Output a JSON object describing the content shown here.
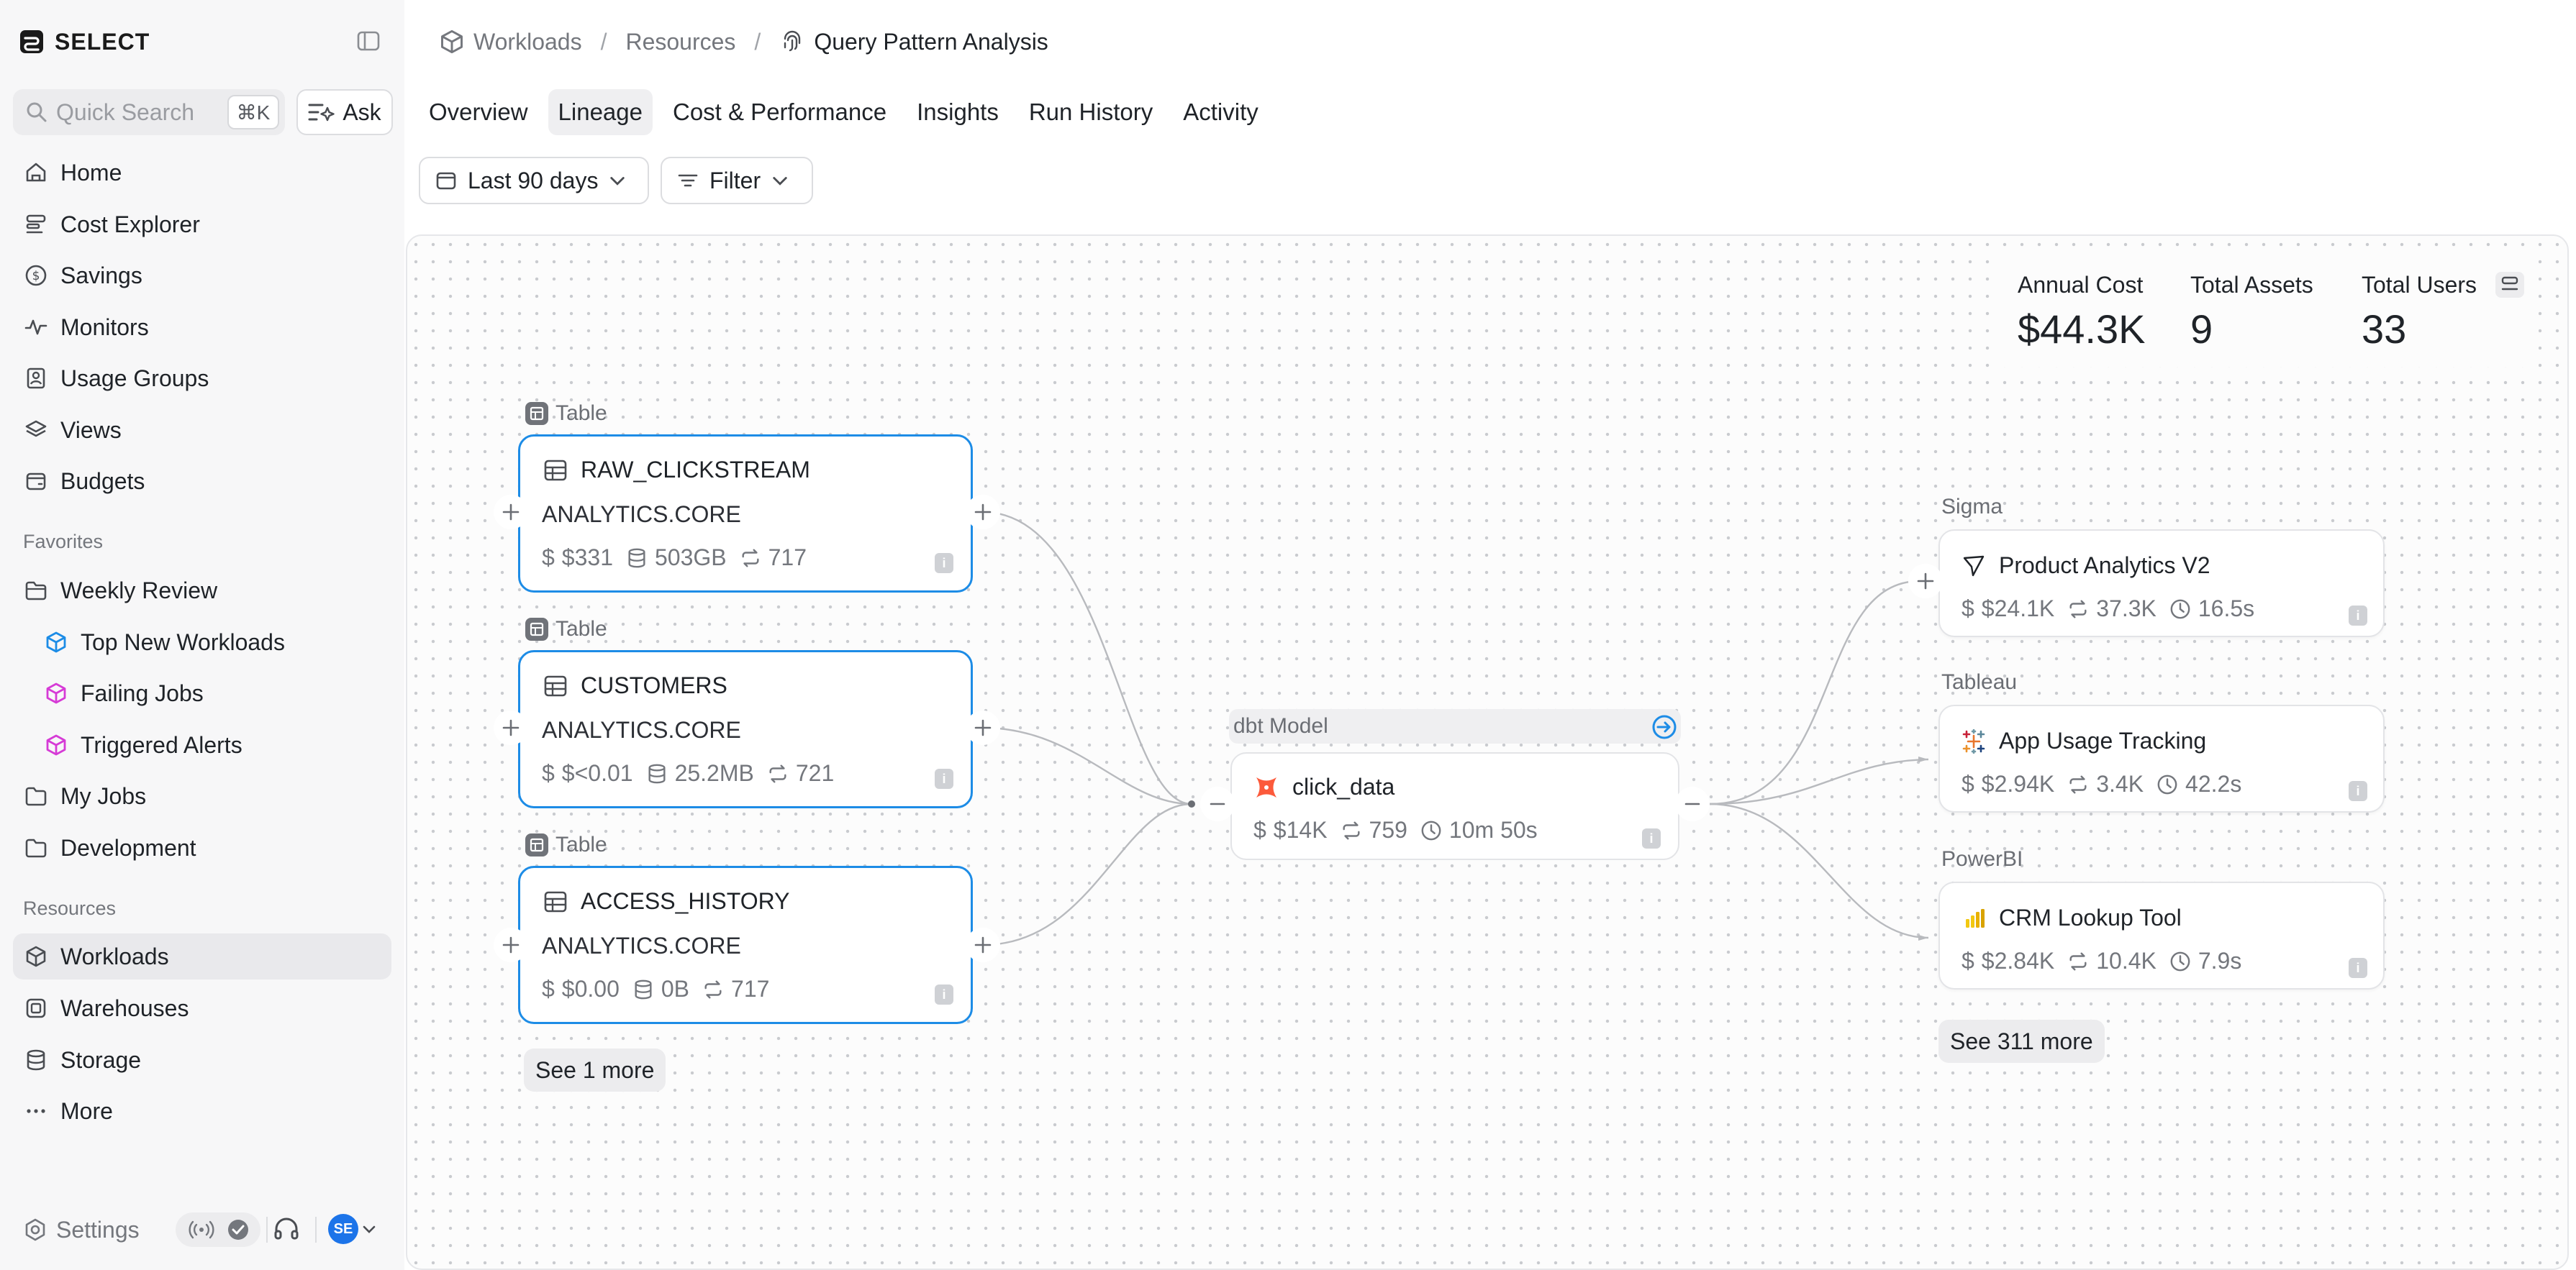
{
  "app": {
    "name": "SELECT"
  },
  "sidebar": {
    "search": {
      "placeholder": "Quick Search",
      "shortcut": "⌘K"
    },
    "ask_label": "Ask",
    "nav": [
      {
        "label": "Home",
        "icon": "home-icon"
      },
      {
        "label": "Cost Explorer",
        "icon": "cost-explorer-icon"
      },
      {
        "label": "Savings",
        "icon": "dollar-circle-icon"
      },
      {
        "label": "Monitors",
        "icon": "activity-icon"
      },
      {
        "label": "Usage Groups",
        "icon": "usage-groups-icon"
      },
      {
        "label": "Views",
        "icon": "layers-icon"
      },
      {
        "label": "Budgets",
        "icon": "wallet-icon"
      }
    ],
    "favorites_label": "Favorites",
    "favorites": [
      {
        "label": "Weekly Review",
        "icon": "folder-icon"
      },
      {
        "label": "Top New Workloads",
        "icon": "cube-icon",
        "color": "#1c8ce6"
      },
      {
        "label": "Failing Jobs",
        "icon": "cube-icon",
        "color": "#d63bd6"
      },
      {
        "label": "Triggered Alerts",
        "icon": "cube-icon",
        "color": "#d63bd6"
      },
      {
        "label": "My Jobs",
        "icon": "folder-icon"
      },
      {
        "label": "Development",
        "icon": "folder-icon"
      }
    ],
    "resources_label": "Resources",
    "resources": [
      {
        "label": "Workloads",
        "icon": "cube-icon",
        "active": true
      },
      {
        "label": "Warehouses",
        "icon": "warehouse-icon"
      },
      {
        "label": "Storage",
        "icon": "database-icon"
      },
      {
        "label": "More",
        "icon": "more-icon"
      }
    ],
    "settings_label": "Settings",
    "user_initials": "SE"
  },
  "breadcrumb": {
    "items": [
      "Workloads",
      "Resources"
    ],
    "current": "Query Pattern Analysis"
  },
  "tabs": [
    "Overview",
    "Lineage",
    "Cost & Performance",
    "Insights",
    "Run History",
    "Activity"
  ],
  "active_tab": "Lineage",
  "controls": {
    "date_range": "Last 90 days",
    "filter": "Filter"
  },
  "stats": {
    "annual_cost_label": "Annual Cost",
    "annual_cost": "$44.3K",
    "total_assets_label": "Total Assets",
    "total_assets": "9",
    "total_users_label": "Total Users",
    "total_users": "33"
  },
  "upstream": {
    "type_label": "Table",
    "nodes": [
      {
        "name": "RAW_CLICKSTREAM",
        "schema": "ANALYTICS.CORE",
        "cost": "$331",
        "size": "503GB",
        "runs": "717"
      },
      {
        "name": "CUSTOMERS",
        "schema": "ANALYTICS.CORE",
        "cost": "$<0.01",
        "size": "25.2MB",
        "runs": "721"
      },
      {
        "name": "ACCESS_HISTORY",
        "schema": "ANALYTICS.CORE",
        "cost": "$0.00",
        "size": "0B",
        "runs": "717"
      }
    ],
    "see_more": "See 1 more"
  },
  "model": {
    "type_label": "dbt Model",
    "name": "click_data",
    "cost": "$14K",
    "runs": "759",
    "duration": "10m 50s"
  },
  "downstream": {
    "groups": [
      {
        "label": "Sigma",
        "name": "Product Analytics V2",
        "cost": "$24.1K",
        "runs": "37.3K",
        "duration": "16.5s"
      },
      {
        "label": "Tableau",
        "name": "App Usage Tracking",
        "cost": "$2.94K",
        "runs": "3.4K",
        "duration": "42.2s"
      },
      {
        "label": "PowerBI",
        "name": "CRM Lookup Tool",
        "cost": "$2.84K",
        "runs": "10.4K",
        "duration": "7.9s"
      }
    ],
    "see_more": "See 311 more"
  },
  "colors": {
    "accent": "#1d8ce6",
    "avatar": "#1c74e9",
    "magenta": "#d63bd6",
    "dbt": "#fc5a3b",
    "powerbi": "#f2c811"
  }
}
